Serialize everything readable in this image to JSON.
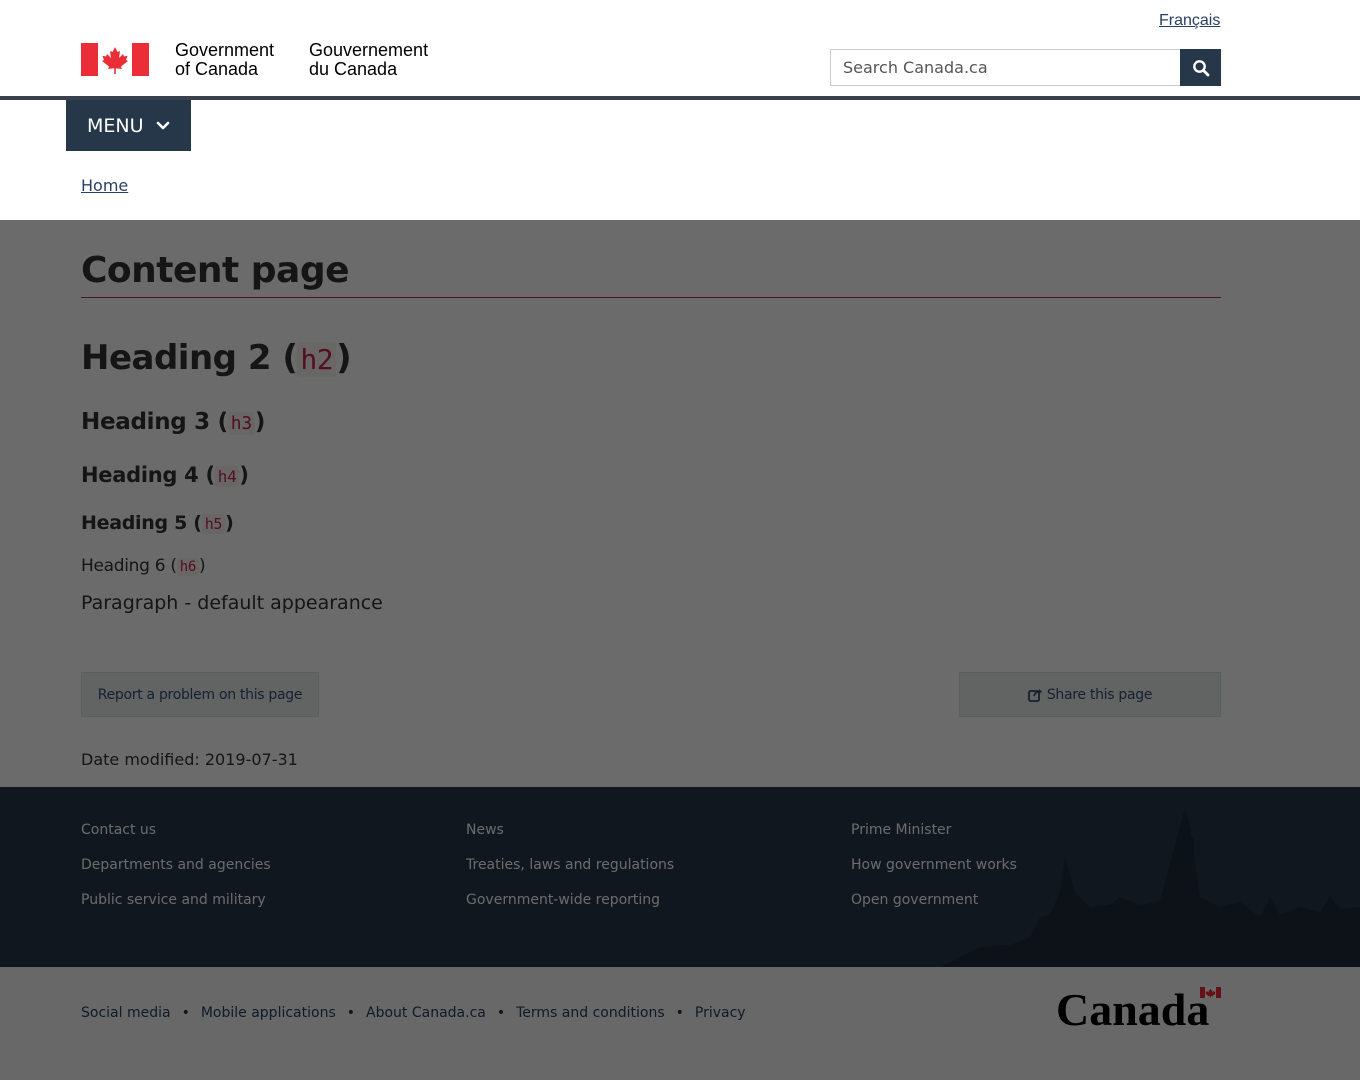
{
  "header": {
    "language_link": "Français",
    "signature_en_line1": "Government",
    "signature_en_line2": "of Canada",
    "signature_fr_line1": "Gouvernement",
    "signature_fr_line2": "du Canada",
    "search_placeholder": "Search Canada.ca",
    "menu_label": "MENU",
    "breadcrumb_home": "Home"
  },
  "main": {
    "title": "Content page",
    "headings": [
      {
        "text": "Heading 2",
        "tag": "h2"
      },
      {
        "text": "Heading 3",
        "tag": "h3"
      },
      {
        "text": "Heading 4",
        "tag": "h4"
      },
      {
        "text": "Heading 5",
        "tag": "h5"
      },
      {
        "text": "Heading 6",
        "tag": "h6"
      }
    ],
    "paragraph": "Paragraph - default appearance",
    "report_button": "Report a problem on this page",
    "share_button": "Share this page",
    "date_modified_label": "Date modified:",
    "date_modified_value": "2019-07-31"
  },
  "footer": {
    "columns": [
      [
        "Contact us",
        "Departments and agencies",
        "Public service and military"
      ],
      [
        "News",
        "Treaties, laws and regulations",
        "Government-wide reporting"
      ],
      [
        "Prime Minister",
        "How government works",
        "Open government"
      ]
    ],
    "sub_links": [
      "Social media",
      "Mobile applications",
      "About Canada.ca",
      "Terms and conditions",
      "Privacy"
    ],
    "wordmark": "Canada"
  },
  "colors": {
    "primary_dark": "#26374a",
    "accent_red": "#af3c43",
    "flag_red": "#eb2d37",
    "link": "#284162"
  }
}
